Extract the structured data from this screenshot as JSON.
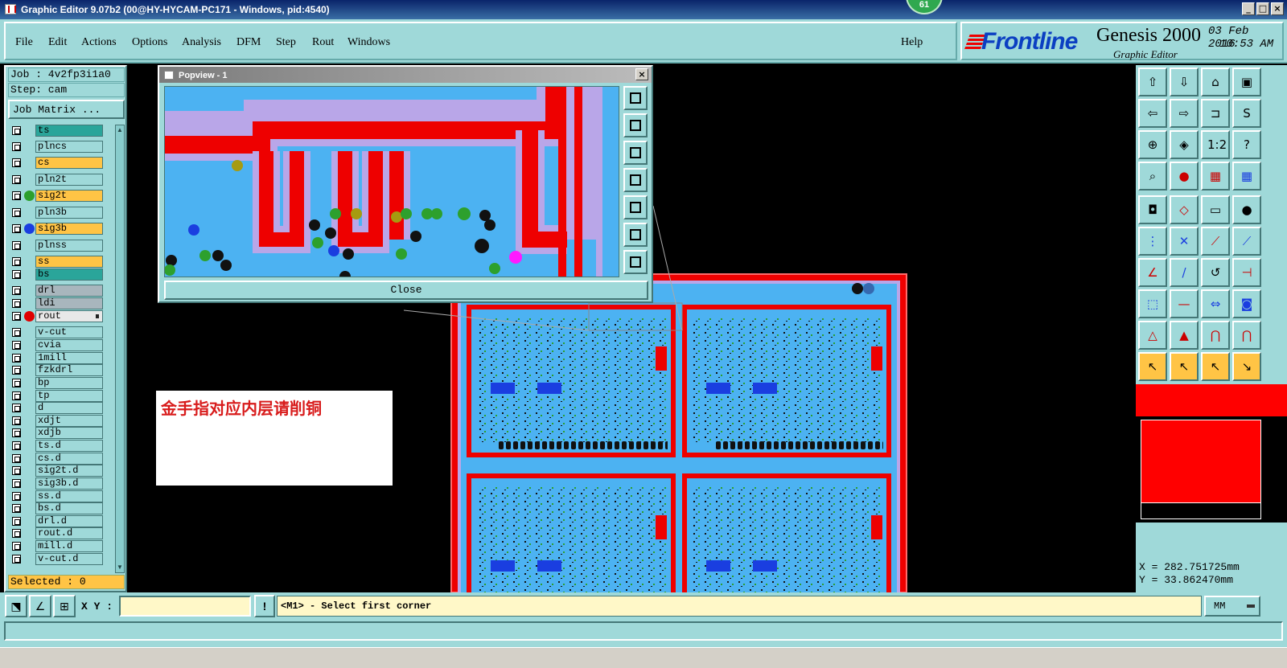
{
  "window": {
    "title": "Graphic Editor 9.07b2 (00@HY-HYCAM-PC171 - Windows, pid:4540)",
    "badge": "61",
    "controls": [
      "_",
      "□",
      "×"
    ]
  },
  "menu": {
    "items": [
      "File",
      "Edit",
      "Actions",
      "Options",
      "Analysis",
      "DFM",
      "Step",
      "Rout",
      "Windows"
    ],
    "help": "Help"
  },
  "logo": {
    "brand": "Frontline",
    "product": "Genesis 2000",
    "subtitle": "Graphic Editor",
    "date": "03 Feb 2016",
    "time": "10:53 AM"
  },
  "left_panel": {
    "job": "Job : 4v2fp3i1a0",
    "step": "Step: cam",
    "job_matrix": "Job Matrix ...",
    "selected": "Selected : 0",
    "layers": [
      {
        "name": "ts",
        "color": "#2aa59a",
        "dot": ""
      },
      {
        "name": "plncs",
        "color": "#9fd9d9",
        "dot": ""
      },
      {
        "name": "cs",
        "color": "#ffc445",
        "dot": ""
      },
      {
        "name": "pln2t",
        "color": "#9fd9d9",
        "dot": ""
      },
      {
        "name": "sig2t",
        "color": "#ffc445",
        "dot": "#2da02d"
      },
      {
        "name": "pln3b",
        "color": "#9fd9d9",
        "dot": ""
      },
      {
        "name": "sig3b",
        "color": "#ffc445",
        "dot": "#1a3ee0"
      },
      {
        "name": "plnss",
        "color": "#9fd9d9",
        "dot": ""
      },
      {
        "name": "ss",
        "color": "#ffc445",
        "dot": ""
      },
      {
        "name": "bs",
        "color": "#2aa59a",
        "dot": ""
      },
      {
        "name": "drl",
        "color": "#a8b6bd",
        "dot": ""
      },
      {
        "name": "ldi",
        "color": "#a8b6bd",
        "dot": ""
      },
      {
        "name": "rout",
        "color": "#e8e8e8",
        "dot": "#e00000"
      },
      {
        "name": "v-cut",
        "color": "#9fd9d9",
        "dot": ""
      },
      {
        "name": "cvia",
        "color": "#9fd9d9",
        "dot": ""
      },
      {
        "name": "1mill",
        "color": "#9fd9d9",
        "dot": ""
      },
      {
        "name": "fzkdrl",
        "color": "#9fd9d9",
        "dot": ""
      },
      {
        "name": "bp",
        "color": "#9fd9d9",
        "dot": ""
      },
      {
        "name": "tp",
        "color": "#9fd9d9",
        "dot": ""
      },
      {
        "name": "d",
        "color": "#9fd9d9",
        "dot": ""
      },
      {
        "name": "xdjt",
        "color": "#9fd9d9",
        "dot": ""
      },
      {
        "name": "xdjb",
        "color": "#9fd9d9",
        "dot": ""
      },
      {
        "name": "ts.d",
        "color": "#9fd9d9",
        "dot": ""
      },
      {
        "name": "cs.d",
        "color": "#9fd9d9",
        "dot": ""
      },
      {
        "name": "sig2t.d",
        "color": "#9fd9d9",
        "dot": ""
      },
      {
        "name": "sig3b.d",
        "color": "#9fd9d9",
        "dot": ""
      },
      {
        "name": "ss.d",
        "color": "#9fd9d9",
        "dot": ""
      },
      {
        "name": "bs.d",
        "color": "#9fd9d9",
        "dot": ""
      },
      {
        "name": "drl.d",
        "color": "#9fd9d9",
        "dot": ""
      },
      {
        "name": "rout.d",
        "color": "#9fd9d9",
        "dot": ""
      },
      {
        "name": "mill.d",
        "color": "#9fd9d9",
        "dot": ""
      },
      {
        "name": "v-cut.d",
        "color": "#9fd9d9",
        "dot": ""
      }
    ]
  },
  "popview": {
    "title": "Popview - 1",
    "close_label": "Close",
    "tools": [
      "zoom-fit-icon",
      "pan-up-icon",
      "pan-down-icon",
      "pan-left-icon",
      "pan-right-icon",
      "zoom-out-icon",
      "zoom-in-icon"
    ]
  },
  "annotation": {
    "text": "金手指对应内层请削铜"
  },
  "right_tools": [
    {
      "icon": "home-up-icon",
      "glyph": "⇧",
      "style": ""
    },
    {
      "icon": "home-down-icon",
      "glyph": "⇩",
      "style": ""
    },
    {
      "icon": "house-icon",
      "glyph": "⌂",
      "style": ""
    },
    {
      "icon": "window-icon",
      "glyph": "▣",
      "style": ""
    },
    {
      "icon": "pan-left-icon",
      "glyph": "⇦",
      "style": ""
    },
    {
      "icon": "pan-right-icon",
      "glyph": "⇨",
      "style": ""
    },
    {
      "icon": "split-icon",
      "glyph": "⊐",
      "style": ""
    },
    {
      "icon": "snap-icon",
      "glyph": "S",
      "style": ""
    },
    {
      "icon": "zoom-out-icon",
      "glyph": "⊕",
      "style": ""
    },
    {
      "icon": "zoom-center-icon",
      "glyph": "◈",
      "style": ""
    },
    {
      "icon": "scale-1-2-icon",
      "glyph": "1:2",
      "style": ""
    },
    {
      "icon": "help-icon",
      "glyph": "?",
      "style": ""
    },
    {
      "icon": "measure-icon",
      "glyph": "⌕",
      "style": ""
    },
    {
      "icon": "probe-icon",
      "glyph": "●",
      "style": "red"
    },
    {
      "icon": "layers-red-icon",
      "glyph": "▦",
      "style": "red"
    },
    {
      "icon": "layers-blue-icon",
      "glyph": "▦",
      "style": "blue"
    },
    {
      "icon": "select-box-icon",
      "glyph": "◘",
      "style": ""
    },
    {
      "icon": "transform-icon",
      "glyph": "◇",
      "style": "red"
    },
    {
      "icon": "ruler-icon",
      "glyph": "▭",
      "style": ""
    },
    {
      "icon": "pad-icon",
      "glyph": "●",
      "style": ""
    },
    {
      "icon": "connect-icon",
      "glyph": "⋮",
      "style": "blue"
    },
    {
      "icon": "cross-icon",
      "glyph": "✕",
      "style": "blue"
    },
    {
      "icon": "line-red-icon",
      "glyph": "⟋",
      "style": "red"
    },
    {
      "icon": "line-blue-icon",
      "glyph": "⟋",
      "style": "blue"
    },
    {
      "icon": "angle-icon",
      "glyph": "∠",
      "style": "red"
    },
    {
      "icon": "slash-icon",
      "glyph": "/",
      "style": "blue"
    },
    {
      "icon": "rotate-icon",
      "glyph": "↺",
      "style": ""
    },
    {
      "icon": "mirror-icon",
      "glyph": "⊣",
      "style": "red"
    },
    {
      "icon": "move-icon",
      "glyph": "⬚",
      "style": "blue"
    },
    {
      "icon": "dash-icon",
      "glyph": "—",
      "style": "red"
    },
    {
      "icon": "resize-icon",
      "glyph": "⇔",
      "style": "blue"
    },
    {
      "icon": "group-icon",
      "glyph": "◙",
      "style": "blue"
    },
    {
      "icon": "triangle-icon",
      "glyph": "△",
      "style": "red"
    },
    {
      "icon": "arrow-up-icon",
      "glyph": "▲",
      "style": "red"
    },
    {
      "icon": "arc-icon",
      "glyph": "⋂",
      "style": "red"
    },
    {
      "icon": "arc-2-icon",
      "glyph": "⋂",
      "style": "red"
    },
    {
      "icon": "pointer-icon",
      "glyph": "↖",
      "style": "orange"
    },
    {
      "icon": "pointer-box-icon",
      "glyph": "↖",
      "style": "orange"
    },
    {
      "icon": "pointer-circle-icon",
      "glyph": "↖",
      "style": "orange"
    },
    {
      "icon": "pointer-net-icon",
      "glyph": "↘",
      "style": "orange"
    }
  ],
  "coords": {
    "x": "X = 282.751725mm",
    "y": "Y = 33.862470mm"
  },
  "bottom": {
    "xy_label": "X Y :",
    "xy_value": "",
    "warn": "!",
    "status": "<M1> - Select first corner",
    "units": "MM"
  }
}
